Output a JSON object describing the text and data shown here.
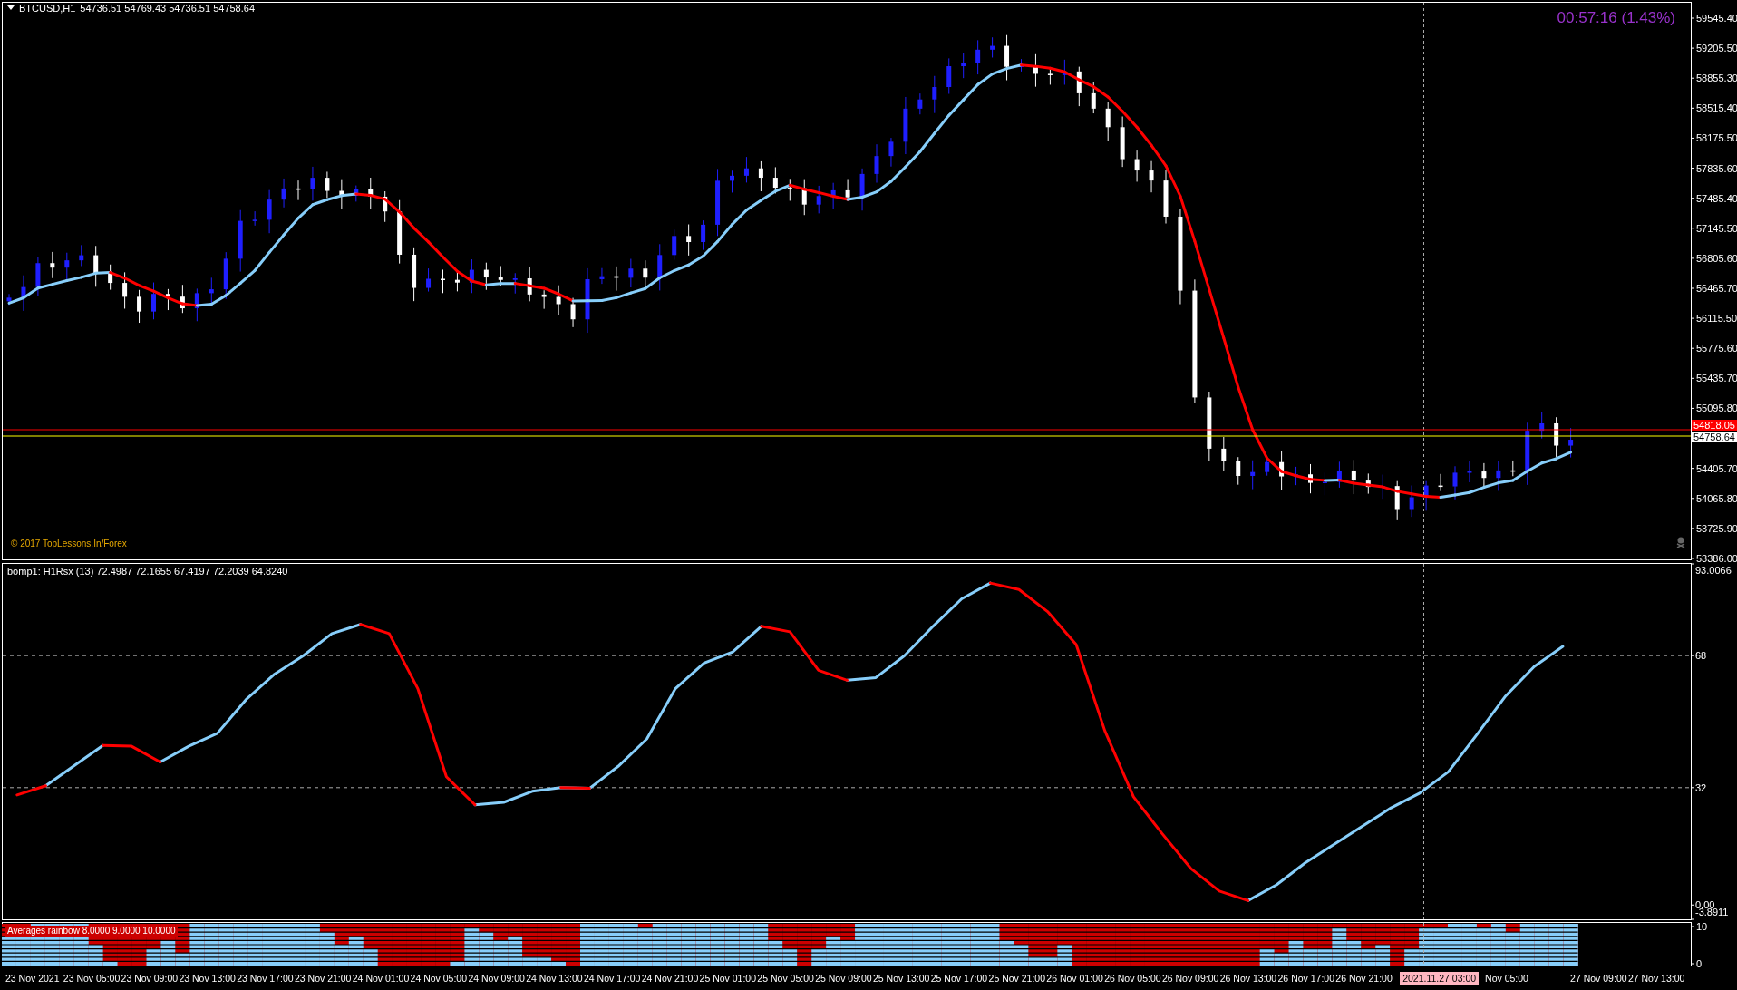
{
  "main_chart": {
    "symbol": "BTCUSD,H1",
    "quote": "54736.51 54769.43 54736.51 54758.64",
    "timer": "00:57:16 (1.43%)",
    "copyright": "© 2017 TopLessons.In/Forex",
    "price_axis": [
      "59545.40",
      "59205.50",
      "58855.30",
      "58515.40",
      "58175.50",
      "57835.60",
      "57485.40",
      "57145.50",
      "56805.60",
      "56465.70",
      "56115.50",
      "55775.60",
      "55435.70",
      "55095.80",
      "54405.70",
      "54065.80",
      "53725.90",
      "53386.00"
    ],
    "price_tags": [
      {
        "text": "54818.05",
        "kind": "ask"
      },
      {
        "text": "54758.64",
        "kind": "bid"
      }
    ]
  },
  "indicator": {
    "title": "bomp1: H1Rsx (13) 72.4987 72.1655 67.4197 72.2039 64.8240",
    "chart_data": {
      "type": "line",
      "categories": [
        null,
        null,
        null,
        null,
        null,
        null,
        null,
        null,
        null,
        null,
        null,
        null,
        null,
        null,
        null,
        null,
        null,
        null,
        null,
        null,
        null,
        null,
        null,
        null,
        null,
        null,
        null,
        null,
        null,
        null,
        null,
        null,
        null,
        null,
        null,
        null,
        null,
        null,
        null,
        null,
        null,
        null,
        null,
        null,
        null,
        null,
        null,
        null,
        null,
        null,
        null,
        null,
        null,
        null,
        null,
        null,
        null,
        null,
        null
      ],
      "grid": true,
      "series": [
        {
          "color": "#87cefa",
          "values": [
            null,
            32.5,
            38,
            43.5,
            null,
            39,
            43.3,
            46.8,
            56,
            63,
            68,
            74,
            76.5,
            null,
            null,
            null,
            27.3,
            28,
            31,
            32,
            31.8,
            37.8,
            45.3,
            59,
            66,
            69,
            76,
            null,
            null,
            61.3,
            62,
            68,
            76,
            83.5,
            87.8,
            null,
            null,
            null,
            null,
            null,
            null,
            null,
            null,
            1.2,
            5.5,
            11.5,
            16.5,
            21.5,
            26.5,
            30.5,
            36.3,
            46.5,
            57,
            65,
            70.5,
            null,
            null,
            null,
            null
          ]
        },
        {
          "color": "#ff0000",
          "values": [
            30,
            32.5,
            null,
            43.5,
            43.3,
            39,
            null,
            null,
            null,
            null,
            null,
            null,
            76.5,
            74,
            59,
            35,
            27.3,
            null,
            null,
            32,
            31.8,
            null,
            null,
            null,
            null,
            null,
            76,
            74.5,
            64,
            61.3,
            null,
            null,
            null,
            null,
            87.8,
            86,
            80,
            71,
            47.5,
            29.5,
            19.5,
            10,
            3.8,
            1.2,
            null,
            null,
            null,
            null,
            null,
            null,
            null,
            null,
            null,
            null,
            null,
            null,
            null,
            null,
            null
          ]
        }
      ],
      "ylim": [
        -3.8911,
        93.0066
      ],
      "yticks": [
        {
          "value": 93.0066,
          "label": "93.0066"
        },
        {
          "value": 68,
          "label": "68"
        },
        {
          "value": 32,
          "label": "32"
        },
        {
          "value": 0,
          "label": "0.00"
        },
        {
          "value": -3.8911,
          "label": "-3.8911"
        }
      ]
    }
  },
  "rainbow": {
    "title": "Averages rainbow 8.0000 9.0000 10.0000",
    "axis": [
      "10",
      "0"
    ]
  },
  "time_axis": [
    {
      "text": "23 Nov 2021",
      "kind": "tick"
    },
    {
      "text": "23 Nov 05:00",
      "kind": "tick"
    },
    {
      "text": "23 Nov 09:00",
      "kind": "tick"
    },
    {
      "text": "23 Nov 13:00",
      "kind": "tick"
    },
    {
      "text": "23 Nov 17:00",
      "kind": "tick"
    },
    {
      "text": "23 Nov 21:00",
      "kind": "tick"
    },
    {
      "text": "24 Nov 01:00",
      "kind": "tick"
    },
    {
      "text": "24 Nov 05:00",
      "kind": "tick"
    },
    {
      "text": "24 Nov 09:00",
      "kind": "tick"
    },
    {
      "text": "24 Nov 13:00",
      "kind": "tick"
    },
    {
      "text": "24 Nov 17:00",
      "kind": "tick"
    },
    {
      "text": "24 Nov 21:00",
      "kind": "tick"
    },
    {
      "text": "25 Nov 01:00",
      "kind": "tick"
    },
    {
      "text": "25 Nov 05:00",
      "kind": "tick"
    },
    {
      "text": "25 Nov 09:00",
      "kind": "tick"
    },
    {
      "text": "25 Nov 13:00",
      "kind": "tick"
    },
    {
      "text": "25 Nov 17:00",
      "kind": "tick"
    },
    {
      "text": "25 Nov 21:00",
      "kind": "tick"
    },
    {
      "text": "26 Nov 01:00",
      "kind": "tick"
    },
    {
      "text": "26 Nov 05:00",
      "kind": "tick"
    },
    {
      "text": "26 Nov 09:00",
      "kind": "tick"
    },
    {
      "text": "26 Nov 13:00",
      "kind": "tick"
    },
    {
      "text": "26 Nov 17:00",
      "kind": "tick"
    },
    {
      "text": "26 Nov 21:00",
      "kind": "tick"
    },
    {
      "text": "2021.11.27 03:00",
      "kind": "cursor"
    },
    {
      "text": "Nov 05:00",
      "kind": "tick"
    },
    {
      "text": "27 Nov 09:00",
      "kind": "tick"
    },
    {
      "text": "27 Nov 13:00",
      "kind": "tick"
    }
  ]
}
